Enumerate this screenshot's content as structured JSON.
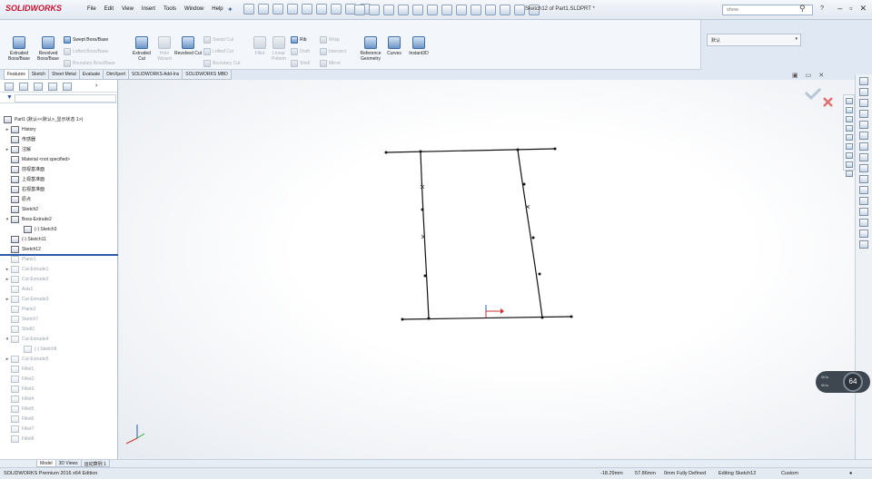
{
  "app": {
    "logo": "SOLIDWORKS",
    "menu": [
      "File",
      "Edit",
      "View",
      "Insert",
      "Tools",
      "Window",
      "Help"
    ],
    "document_title": "Sketch12 of Part1.SLDPRT *",
    "search_placeholder": "show",
    "help_icon": "?"
  },
  "ribbon": {
    "extruded_boss": "Extruded Boss/Base",
    "revolved_boss": "Revolved Boss/Base",
    "swept_boss": "Swept Boss/Base",
    "lofted_boss": "Lofted Boss/Base",
    "boundary_boss": "Boundary Boss/Base",
    "extruded_cut": "Extruded Cut",
    "hole_wizard": "Hole Wizard",
    "revolved_cut": "Revolved Cut",
    "swept_cut": "Swept Cut",
    "lofted_cut": "Lofted Cut",
    "boundary_cut": "Boundary Cut",
    "fillet": "Fillet",
    "linear_pattern": "Linear Pattern",
    "rib": "Rib",
    "draft": "Draft",
    "shell": "Shell",
    "wrap": "Wrap",
    "intersect": "Intersect",
    "mirror": "Mirror",
    "reference_geometry": "Reference Geometry",
    "curves": "Curves",
    "instant3d": "Instant3D",
    "config_value": "默认"
  },
  "tabs": [
    "Features",
    "Sketch",
    "Sheet Metal",
    "Evaluate",
    "DimXpert",
    "SOLIDWORKS Add-Ins",
    "SOLIDWORKS MBD"
  ],
  "tree": {
    "root": "Part1 (默认<<默认>_显示状态 1>)",
    "items": [
      {
        "label": "History",
        "dim": false,
        "exp": "▸"
      },
      {
        "label": "传感器",
        "dim": false,
        "exp": ""
      },
      {
        "label": "注解",
        "dim": false,
        "exp": "▸"
      },
      {
        "label": "Material <not specified>",
        "dim": false,
        "exp": ""
      },
      {
        "label": "前视基准面",
        "dim": false,
        "exp": ""
      },
      {
        "label": "上视基准面",
        "dim": false,
        "exp": ""
      },
      {
        "label": "右视基准面",
        "dim": false,
        "exp": ""
      },
      {
        "label": "原点",
        "dim": false,
        "exp": ""
      },
      {
        "label": "Sketch2",
        "dim": false,
        "exp": ""
      },
      {
        "label": "Boss-Extrude2",
        "dim": false,
        "exp": "▾"
      },
      {
        "label": "(-) Sketch3",
        "dim": false,
        "exp": "",
        "indent": true
      },
      {
        "label": "(-) Sketch11",
        "dim": false,
        "exp": ""
      },
      {
        "label": "Sketch12",
        "dim": false,
        "exp": ""
      },
      {
        "label": "Plane1",
        "dim": true,
        "exp": ""
      },
      {
        "label": "Cut-Extrude1",
        "dim": true,
        "exp": "▸"
      },
      {
        "label": "Cut-Extrude2",
        "dim": true,
        "exp": "▸"
      },
      {
        "label": "Axis1",
        "dim": true,
        "exp": ""
      },
      {
        "label": "Cut-Extrude3",
        "dim": true,
        "exp": "▸"
      },
      {
        "label": "Plane2",
        "dim": true,
        "exp": ""
      },
      {
        "label": "Sketch7",
        "dim": true,
        "exp": ""
      },
      {
        "label": "Shell2",
        "dim": true,
        "exp": ""
      },
      {
        "label": "Cut-Extrude4",
        "dim": true,
        "exp": "▾"
      },
      {
        "label": "(-) Sketch8",
        "dim": true,
        "exp": "",
        "indent": true
      },
      {
        "label": "Cut-Extrude5",
        "dim": true,
        "exp": "▸"
      },
      {
        "label": "Fillet1",
        "dim": true,
        "exp": ""
      },
      {
        "label": "Fillet2",
        "dim": true,
        "exp": ""
      },
      {
        "label": "Fillet3",
        "dim": true,
        "exp": ""
      },
      {
        "label": "Fillet4",
        "dim": true,
        "exp": ""
      },
      {
        "label": "Fillet5",
        "dim": true,
        "exp": ""
      },
      {
        "label": "Fillet6",
        "dim": true,
        "exp": ""
      },
      {
        "label": "Fillet7",
        "dim": true,
        "exp": ""
      },
      {
        "label": "Fillet8",
        "dim": true,
        "exp": ""
      }
    ]
  },
  "bottom_tabs": [
    "Model",
    "3D Views",
    "运动算例 1"
  ],
  "status": {
    "edition": "SOLIDWORKS Premium 2016 x64 Edition",
    "x": "-18.29mm",
    "y": "57.86mm",
    "z": "0mm",
    "state": "Fully Defined",
    "editing": "Editing Sketch12",
    "units": "Custom"
  },
  "perf": {
    "gauge": "64",
    "upload": "0K/s",
    "download": "0K/s"
  },
  "colors": {
    "accent": "#2a5caa",
    "cancel": "#e07070",
    "logo": "#c8102e"
  }
}
